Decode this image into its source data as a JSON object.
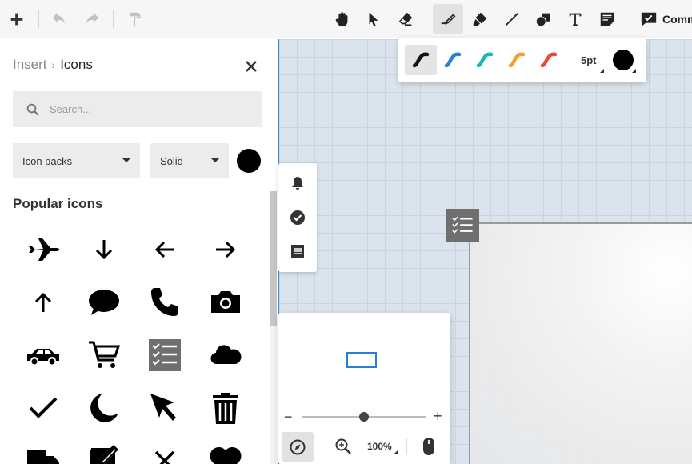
{
  "toolbar": {
    "items": [
      "add",
      "undo",
      "redo",
      "format-painter",
      "pan",
      "select",
      "eraser",
      "pen",
      "highlighter",
      "line",
      "shapes",
      "text",
      "sticky-note"
    ],
    "active_tool": "pen",
    "comments_label": "Comm"
  },
  "panel": {
    "breadcrumb_parent": "Insert",
    "breadcrumb_current": "Icons",
    "search_placeholder": "Search...",
    "icon_pack_label": "Icon packs",
    "style_label": "Solid",
    "icon_color": "#000000",
    "section_title": "Popular icons",
    "icons": [
      "airplane",
      "arrow-down",
      "arrow-left",
      "arrow-right",
      "arrow-up",
      "speech-bubble",
      "phone",
      "camera",
      "car",
      "shopping-cart",
      "checklist",
      "cloud",
      "checkmark",
      "moon",
      "cursor-arrow",
      "trash",
      "truck",
      "edit-note",
      "close-x",
      "heart"
    ]
  },
  "pen_popup": {
    "pen_colors": [
      "#111111",
      "#2b7fd6",
      "#1fb5b5",
      "#f2a030",
      "#e84a3a"
    ],
    "selected_pen": 0,
    "size_label": "5pt",
    "color": "#000000"
  },
  "navigator": {
    "zoom_label": "100%",
    "zoom_level": 0.5
  },
  "colors": {
    "accent": "#3d8fd6",
    "canvas_bg": "#dbe4ec"
  }
}
